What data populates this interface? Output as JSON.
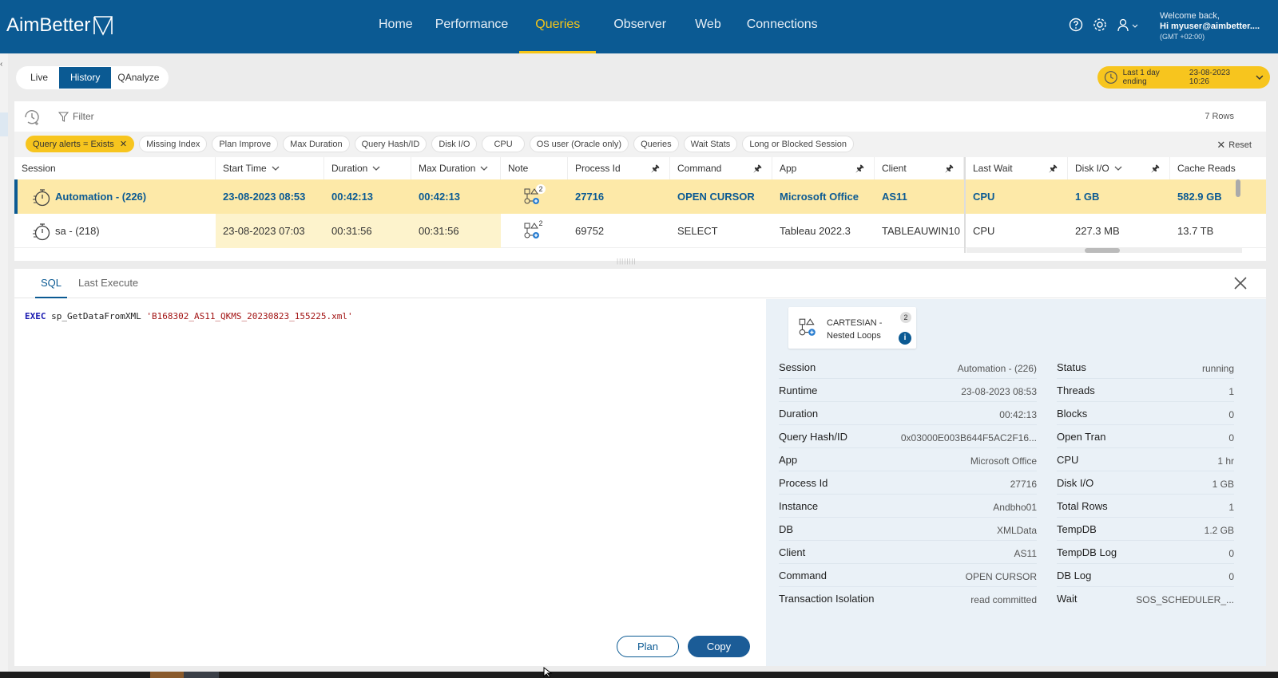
{
  "app": {
    "logo": "AimBetter",
    "nav": [
      "Home",
      "Performance",
      "Queries",
      "Observer",
      "Web",
      "Connections"
    ],
    "active_nav": "Queries",
    "user": {
      "welcome": "Welcome back,",
      "name": "Hi myuser@aimbetter....",
      "tz": "(GMT +02:00)"
    }
  },
  "mode_tabs": {
    "live": "Live",
    "history": "History",
    "qanalyze": "QAnalyze"
  },
  "time_range": {
    "label": "Last 1 day ending",
    "value": "23-08-2023 10:26"
  },
  "filter": {
    "label": "Filter",
    "rows_count": "7 Rows",
    "reset": "Reset",
    "chips": [
      {
        "label": "Query alerts = Exists",
        "active": true
      },
      {
        "label": "Missing Index"
      },
      {
        "label": "Plan Improve"
      },
      {
        "label": "Max Duration"
      },
      {
        "label": "Query Hash/ID"
      },
      {
        "label": "Disk I/O"
      },
      {
        "label": "CPU"
      },
      {
        "label": "OS user (Oracle only)"
      },
      {
        "label": "Queries"
      },
      {
        "label": "Wait Stats"
      },
      {
        "label": "Long or Blocked Session"
      }
    ]
  },
  "grid": {
    "columns": [
      "Session",
      "Start Time",
      "Duration",
      "Max Duration",
      "Note",
      "Process Id",
      "Command",
      "App",
      "Client",
      "Last Wait",
      "Disk I/O",
      "Cache Reads"
    ],
    "rows": [
      {
        "session": "Automation - (226)",
        "start_time": "23-08-2023 08:53",
        "duration": "00:42:13",
        "max_duration": "00:42:13",
        "note_count": "2",
        "process_id": "27716",
        "command": "OPEN CURSOR",
        "app": "Microsoft Office",
        "client": "AS11",
        "last_wait": "CPU",
        "disk_io": "1 GB",
        "cache_reads": "582.9 GB"
      },
      {
        "session": "sa - (218)",
        "start_time": "23-08-2023 07:03",
        "duration": "00:31:56",
        "max_duration": "00:31:56",
        "note_count": "2",
        "process_id": "69752",
        "command": "SELECT",
        "app": "Tableau 2022.3",
        "client": "TABLEAUWIN10",
        "last_wait": "CPU",
        "disk_io": "227.3 MB",
        "cache_reads": "13.7 TB"
      }
    ]
  },
  "detail": {
    "tabs": {
      "sql": "SQL",
      "last_execute": "Last Execute"
    },
    "sql": {
      "keyword": "EXEC",
      "proc": "sp_GetDataFromXML",
      "arg": "'B168302_AS11_QKMS_20230823_155225.xml'"
    },
    "plan_button": "Plan",
    "copy_button": "Copy",
    "plan_card": {
      "line1": "CARTESIAN -",
      "line2": "Nested Loops",
      "badge": "2",
      "info": "i"
    },
    "left_info": [
      {
        "k": "Session",
        "v": "Automation - (226)"
      },
      {
        "k": "Runtime",
        "v": "23-08-2023 08:53"
      },
      {
        "k": "Duration",
        "v": "00:42:13"
      },
      {
        "k": "Query Hash/ID",
        "v": "0x03000E003B644F5AC2F16..."
      },
      {
        "k": "App",
        "v": "Microsoft Office"
      },
      {
        "k": "Process Id",
        "v": "27716"
      },
      {
        "k": "Instance",
        "v": "Andbho01"
      },
      {
        "k": "DB",
        "v": "XMLData"
      },
      {
        "k": "Client",
        "v": "AS11"
      },
      {
        "k": "Command",
        "v": "OPEN CURSOR"
      },
      {
        "k": "Transaction Isolation",
        "v": "read committed"
      }
    ],
    "right_info": [
      {
        "k": "Status",
        "v": "running"
      },
      {
        "k": "Threads",
        "v": "1"
      },
      {
        "k": "Blocks",
        "v": "0"
      },
      {
        "k": "Open Tran",
        "v": "0"
      },
      {
        "k": "CPU",
        "v": "1 hr"
      },
      {
        "k": "Disk I/O",
        "v": "1 GB"
      },
      {
        "k": "Total Rows",
        "v": "1"
      },
      {
        "k": "TempDB",
        "v": "1.2 GB"
      },
      {
        "k": "TempDB Log",
        "v": "0"
      },
      {
        "k": "DB Log",
        "v": "0"
      },
      {
        "k": "Wait",
        "v": "SOS_SCHEDULER_..."
      }
    ]
  },
  "colors": {
    "brand": "#0b5a93",
    "accent": "#f5c518",
    "row_highlight": "#fde9a8"
  }
}
